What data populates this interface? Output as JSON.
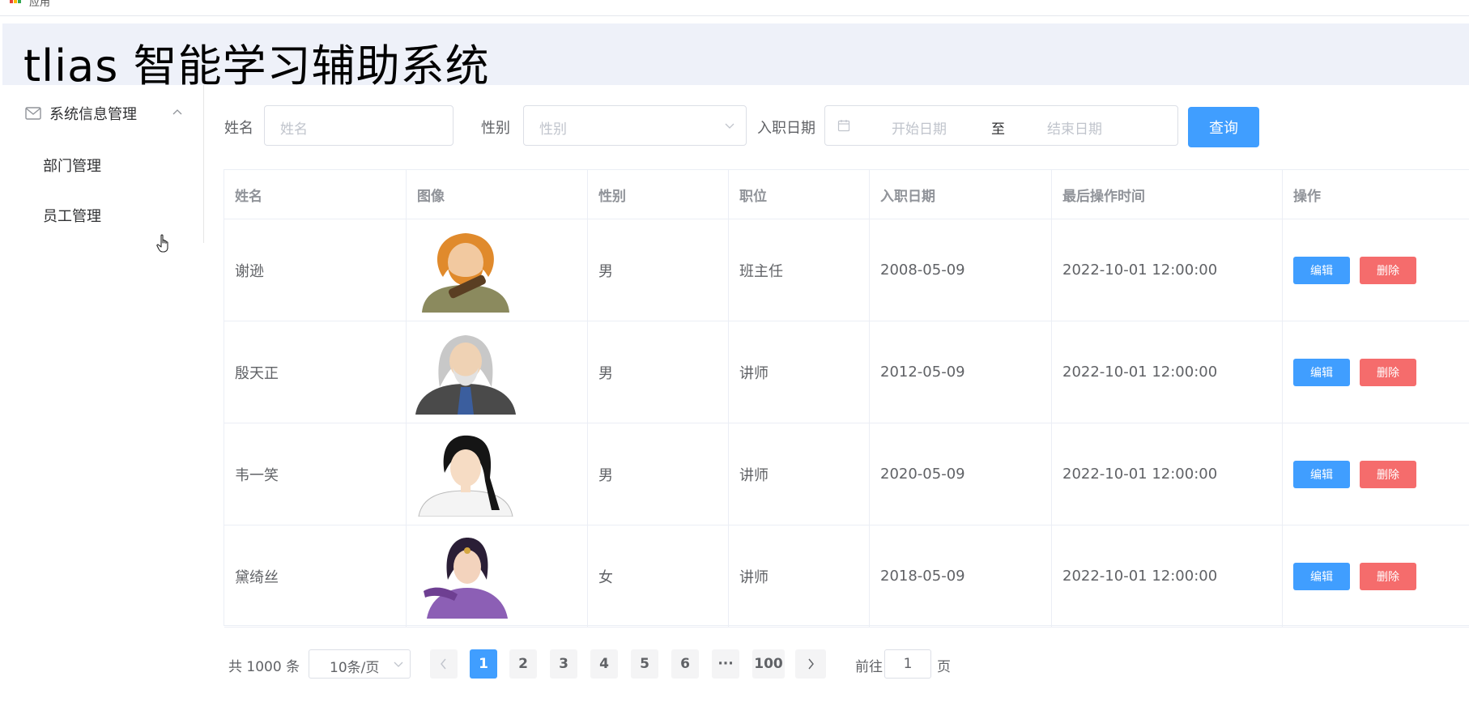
{
  "topbar": {
    "apps_label": "应用"
  },
  "header": {
    "title": "tlias 智能学习辅助系统"
  },
  "sidebar": {
    "group_label": "系统信息管理",
    "items": [
      {
        "label": "部门管理"
      },
      {
        "label": "员工管理"
      }
    ]
  },
  "search": {
    "name_label": "姓名",
    "name_placeholder": "姓名",
    "gender_label": "性别",
    "gender_placeholder": "性别",
    "date_label": "入职日期",
    "start_placeholder": "开始日期",
    "range_separator": "至",
    "end_placeholder": "结束日期",
    "query_button": "查询"
  },
  "table": {
    "columns": [
      "姓名",
      "图像",
      "性别",
      "职位",
      "入职日期",
      "最后操作时间",
      "操作"
    ],
    "rows": [
      {
        "name": "谢逊",
        "avatar": "portrait-old-man-orange-beard",
        "gender": "男",
        "position": "班主任",
        "entry_date": "2008-05-09",
        "update_time": "2022-10-01 12:00:00"
      },
      {
        "name": "殷天正",
        "avatar": "portrait-old-man-white-hair",
        "gender": "男",
        "position": "讲师",
        "entry_date": "2012-05-09",
        "update_time": "2022-10-01 12:00:00"
      },
      {
        "name": "韦一笑",
        "avatar": "portrait-young-man-black-hair",
        "gender": "男",
        "position": "讲师",
        "entry_date": "2020-05-09",
        "update_time": "2022-10-01 12:00:00"
      },
      {
        "name": "黛绮丝",
        "avatar": "portrait-woman-purple-dress",
        "gender": "女",
        "position": "讲师",
        "entry_date": "2018-05-09",
        "update_time": "2022-10-01 12:00:00"
      }
    ],
    "edit_label": "编辑",
    "delete_label": "删除"
  },
  "pagination": {
    "total": "共 1000 条",
    "page_size": "10条/页",
    "pages": [
      "1",
      "2",
      "3",
      "4",
      "5",
      "6",
      "···",
      "100"
    ],
    "current": "1",
    "goto_label": "前往",
    "goto_value": "1",
    "goto_unit": "页"
  },
  "colors": {
    "primary": "#409eff",
    "danger": "#f56c6c",
    "header_bg": "#eef1f9"
  }
}
